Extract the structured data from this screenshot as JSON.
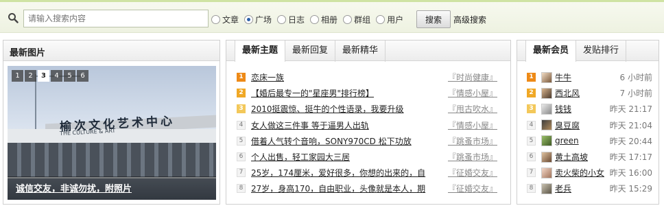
{
  "search": {
    "placeholder": "请输入搜索内容",
    "options": [
      {
        "label": "文章",
        "checked": false
      },
      {
        "label": "广场",
        "checked": true
      },
      {
        "label": "日志",
        "checked": false
      },
      {
        "label": "相册",
        "checked": false
      },
      {
        "label": "群组",
        "checked": false
      },
      {
        "label": "用户",
        "checked": false
      }
    ],
    "button_label": "搜索",
    "advanced_label": "高级搜索"
  },
  "images_panel": {
    "title": "最新图片",
    "pages": [
      "1",
      "2",
      "3",
      "4",
      "5",
      "6"
    ],
    "active_page": "3",
    "photo_sign": "榆次文化艺术中心",
    "photo_sign_sub": "THE CULTURE & ART",
    "caption": "诚信交友，非诚勿扰，附照片"
  },
  "topics_panel": {
    "tabs": [
      {
        "label": "最新主题",
        "active": true
      },
      {
        "label": "最新回复",
        "active": false
      },
      {
        "label": "最新精华",
        "active": false
      }
    ],
    "items": [
      {
        "rank": "1",
        "text": "恋床一族",
        "category": "『时尚健康』"
      },
      {
        "rank": "2",
        "text": "【婚后最专一的\"星座男\"排行榜】",
        "category": "『情感小屋』"
      },
      {
        "rank": "3",
        "text": "2010挺震惊、挺牛的个性语录，我要升级",
        "category": "『甩古吹水』"
      },
      {
        "rank": "4",
        "text": "女人做这三件事 等于逼男人出轨",
        "category": "『情感小屋』"
      },
      {
        "rank": "5",
        "text": "借着人气转个音响，SONY970CD 松下功放",
        "category": "『跳蚤市场』"
      },
      {
        "rank": "6",
        "text": "个人出售，轻工家园大三居",
        "category": "『跳蚤市场』"
      },
      {
        "rank": "7",
        "text": "25岁，174厘米，爱好很多，你想的出来的，自",
        "category": "『征婚交友』"
      },
      {
        "rank": "8",
        "text": "27岁，身高170，自由职业，头像就是本人，期",
        "category": "『征婚交友』"
      }
    ]
  },
  "members_panel": {
    "tabs": [
      {
        "label": "最新会员",
        "active": true
      },
      {
        "label": "发贴排行",
        "active": false
      }
    ],
    "items": [
      {
        "rank": "1",
        "name": "牛牛",
        "time": "6 小时前"
      },
      {
        "rank": "2",
        "name": "西北风",
        "time": "7 小时前"
      },
      {
        "rank": "3",
        "name": "钱钱",
        "time": "昨天 21:17"
      },
      {
        "rank": "4",
        "name": "臭豆腐",
        "time": "昨天 21:04"
      },
      {
        "rank": "5",
        "name": "green",
        "time": "昨天 20:44"
      },
      {
        "rank": "6",
        "name": "黄土高坡",
        "time": "昨天 17:17"
      },
      {
        "rank": "7",
        "name": "卖火柴的小女",
        "time": "昨天 16:00"
      },
      {
        "rank": "8",
        "name": "老兵",
        "time": "昨天 15:29"
      }
    ]
  },
  "colors": {
    "rank1": "#ee8a17",
    "rank2": "#f0a826",
    "rank3": "#f3c85a",
    "accent_bar": "#cfe3a3"
  }
}
